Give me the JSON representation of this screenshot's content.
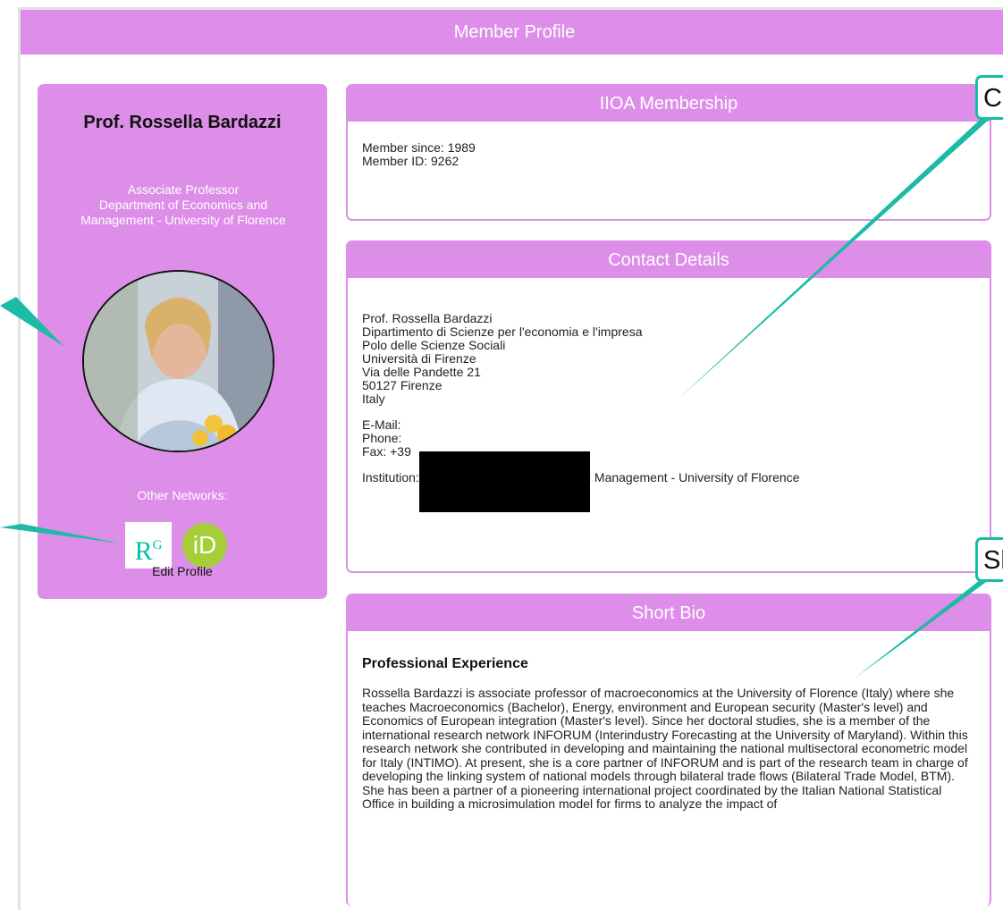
{
  "header": {
    "title": "Member Profile"
  },
  "sidebar": {
    "name": "Prof. Rossella Bardazzi",
    "position": "Associate Professor\nDepartment of Economics and Management - University of Florence",
    "other_networks_label": "Other Networks:",
    "edit_profile_label": "Edit Profile",
    "network_icons": [
      "researchgate-icon",
      "orcid-icon"
    ]
  },
  "membership": {
    "title": "IIOA Membership",
    "member_since": "Member since: 1989",
    "member_id": "Member ID: 9262"
  },
  "contact": {
    "title": "Contact Details",
    "address_lines": [
      "Prof. Rossella Bardazzi",
      "Dipartimento di Scienze per l'economia e l'impresa",
      "Polo delle Scienze Sociali",
      "Università di Firenze",
      "Via delle Pandette 21",
      "50127 Firenze",
      "Italy"
    ],
    "email_label": "E-Mail:",
    "phone_label": "Phone:",
    "fax_label": "Fax: +39",
    "institution": "Institution: Department of Economics and Management - University of Florence"
  },
  "bio": {
    "title": "Short Bio",
    "heading": "Professional Experience",
    "text": "Rossella Bardazzi is associate professor of macroeconomics at the University of Florence (Italy) where she teaches Macroeconomics (Bachelor), Energy, environment and European security (Master's level) and Economics of European integration (Master's level). Since her doctoral studies, she is a member of the international research network INFORUM (Interindustry Forecasting at the University of Maryland). Within this research network she contributed in developing and maintaining the national multisectoral econometric model for Italy (INTIMO). At present, she is a core partner of INFORUM and is part of the research team in charge of developing the linking system of national models through bilateral trade flows (Bilateral Trade Model, BTM). She has been a partner of a pioneering international project coordinated by the Italian National Statistical Office in building a microsimulation model for firms to analyze the impact of"
  },
  "callouts": {
    "contact": "Co",
    "short_bio": "Sh"
  },
  "colors": {
    "accent": "#dd8ee8",
    "callout_teal": "#1bbba6",
    "redaction": "#000000"
  }
}
